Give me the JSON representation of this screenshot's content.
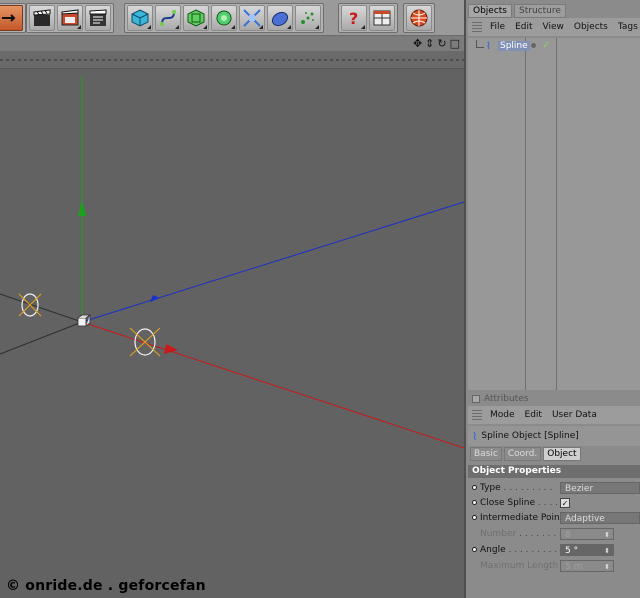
{
  "toolbar": {
    "groups": [
      [
        "move-tool"
      ],
      [
        "render-view",
        "render-picture-viewer",
        "render-settings"
      ],
      [
        "cube-primitive",
        "spline-tools",
        "nurbs-generator",
        "array-modeling",
        "deformers",
        "environment",
        "particles"
      ],
      [
        "help",
        "window-layout"
      ],
      [
        "web-browser"
      ]
    ]
  },
  "viewport": {
    "nav_icons": [
      "move-view-icon",
      "zoom-view-icon",
      "rotate-view-icon",
      "maximize-view-icon"
    ],
    "axis_colors": {
      "y": "#1aa31a",
      "z": "#1a2fc8",
      "x": "#c81a1a",
      "grid": "#2a2a2a",
      "handles": "#e8a41c"
    },
    "watermark": "© onride.de . geforcefan"
  },
  "objects_panel": {
    "tabs": [
      {
        "label": "Objects",
        "active": true
      },
      {
        "label": "Structure",
        "active": false
      }
    ],
    "menu": [
      "File",
      "Edit",
      "View",
      "Objects",
      "Tags"
    ],
    "items": [
      {
        "name": "Spline",
        "icon": "spline-icon",
        "check": "✓"
      }
    ]
  },
  "attributes_panel": {
    "title": "Attributes",
    "menu": [
      "Mode",
      "Edit",
      "User Data"
    ],
    "object_label": "Spline Object [Spline]",
    "tabs": [
      {
        "label": "Basic",
        "active": false
      },
      {
        "label": "Coord.",
        "active": false
      },
      {
        "label": "Object",
        "active": true
      }
    ],
    "section_title": "Object Properties",
    "properties": {
      "type": {
        "label": "Type",
        "dots": ". . . . . . . . .",
        "value": "Bezier"
      },
      "close_spline": {
        "label": "Close Spline",
        "dots": ". . . . .",
        "checked": true
      },
      "intermediate_points": {
        "label": "Intermediate Points",
        "value": "Adaptive"
      },
      "number": {
        "label": "Number",
        "dots": ". . . . . . . .",
        "value": "8"
      },
      "angle": {
        "label": "Angle",
        "dots": ". . . . . . . . .",
        "value": "5 °"
      },
      "maximum_length": {
        "label": "Maximum Length",
        "value": "5 m"
      }
    }
  }
}
